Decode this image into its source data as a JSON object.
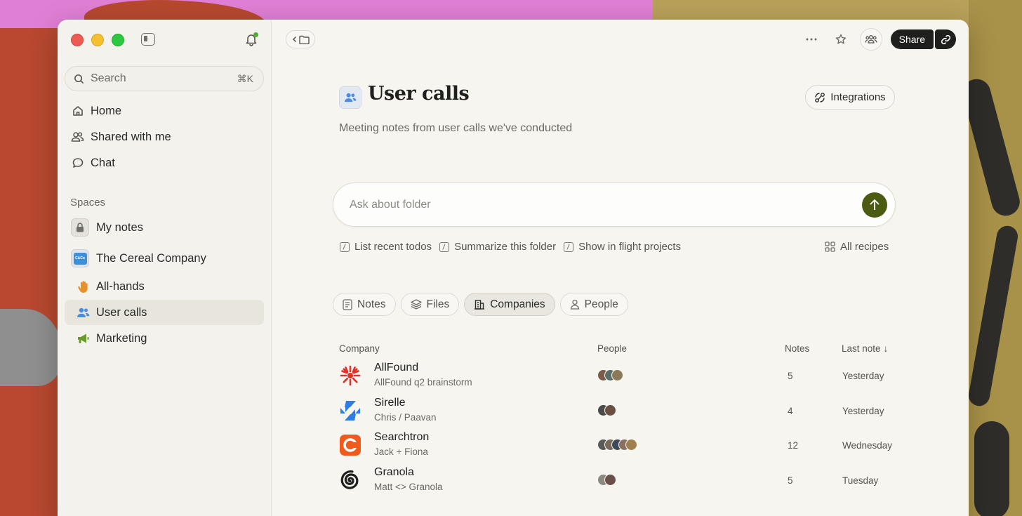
{
  "sidebar": {
    "search": {
      "label": "Search",
      "shortcut": "⌘K"
    },
    "nav": [
      {
        "label": "Home",
        "icon": "home-icon"
      },
      {
        "label": "Shared with me",
        "icon": "people-icon"
      },
      {
        "label": "Chat",
        "icon": "chat-icon"
      }
    ],
    "spaces_title": "Spaces",
    "spaces": [
      {
        "label": "My notes",
        "icon": "lock-icon"
      },
      {
        "label": "The Cereal Company",
        "icon": "cereal-company-logo",
        "badge_text": "C&Co"
      },
      {
        "label": "All-hands",
        "icon": "hand-icon",
        "color": "#e8902a"
      },
      {
        "label": "User calls",
        "icon": "people-icon",
        "color": "#4a8ce0",
        "active": true
      },
      {
        "label": "Marketing",
        "icon": "megaphone-icon",
        "color": "#6a9a2a"
      }
    ]
  },
  "header": {
    "share_label": "Share"
  },
  "page": {
    "title": "User calls",
    "subtitle": "Meeting notes from user calls we've conducted",
    "integrations_label": "Integrations",
    "ask_placeholder": "Ask about folder",
    "recipes": [
      "List recent todos",
      "Summarize this folder",
      "Show in flight projects"
    ],
    "all_recipes_label": "All recipes",
    "tabs": [
      {
        "label": "Notes",
        "icon": "note-icon"
      },
      {
        "label": "Files",
        "icon": "layers-icon"
      },
      {
        "label": "Companies",
        "icon": "building-icon",
        "active": true
      },
      {
        "label": "People",
        "icon": "person-icon"
      }
    ]
  },
  "table": {
    "headers": {
      "company": "Company",
      "people": "People",
      "notes": "Notes",
      "last_note": "Last note"
    },
    "sort_indicator": "↓",
    "rows": [
      {
        "company": "AllFound",
        "subtitle": "AllFound q2 brainstorm",
        "notes": "5",
        "last_note": "Yesterday",
        "logo": "allfound-logo",
        "avatar_colors": [
          "#7a5a48",
          "#5a6e6a",
          "#8a7a5a"
        ]
      },
      {
        "company": "Sirelle",
        "subtitle": "Chris / Paavan",
        "notes": "4",
        "last_note": "Yesterday",
        "logo": "sirelle-logo",
        "avatar_colors": [
          "#4a4a4a",
          "#6a5040"
        ]
      },
      {
        "company": "Searchtron",
        "subtitle": "Jack + Fiona",
        "notes": "12",
        "last_note": "Wednesday",
        "logo": "searchtron-logo",
        "avatar_colors": [
          "#5a5a5a",
          "#7a6a5a",
          "#3a4a5a",
          "#8a7060",
          "#a08050"
        ]
      },
      {
        "company": "Granola",
        "subtitle": "Matt <> Granola",
        "notes": "5",
        "last_note": "Tuesday",
        "logo": "granola-logo",
        "avatar_colors": [
          "#8a8a80",
          "#6a5048"
        ]
      }
    ]
  },
  "colors": {
    "accent_green": "#4b5c12",
    "window_bg": "#f6f5f0",
    "sidebar_active": "#e7e5dc"
  }
}
